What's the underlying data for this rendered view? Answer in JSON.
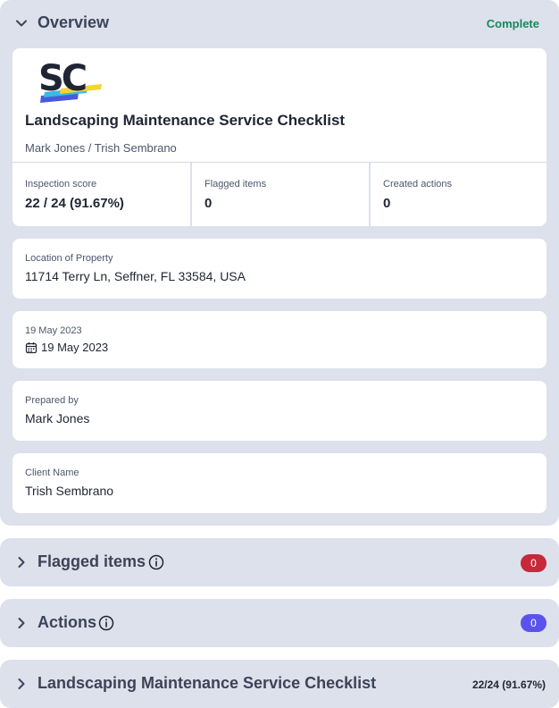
{
  "overview": {
    "title": "Overview",
    "status": "Complete",
    "logo_text": "SC",
    "doc_title": "Landscaping Maintenance Service Checklist",
    "doc_subtitle": "Mark Jones / Trish Sembrano",
    "stats": [
      {
        "label": "Inspection score",
        "value": "22 / 24 (91.67%)"
      },
      {
        "label": "Flagged items",
        "value": "0"
      },
      {
        "label": "Created actions",
        "value": "0"
      }
    ],
    "location": {
      "label": "Location of Property",
      "value": "11714 Terry Ln, Seffner, FL 33584, USA"
    },
    "date": {
      "label": "19 May 2023",
      "value": "19 May 2023",
      "icon": "calendar-icon"
    },
    "prepared_by": {
      "label": "Prepared by",
      "value": "Mark Jones"
    },
    "client": {
      "label": "Client Name",
      "value": "Trish Sembrano"
    }
  },
  "flagged": {
    "title": "Flagged items",
    "count": "0",
    "badge_color": "#c8283a"
  },
  "actions": {
    "title": "Actions",
    "count": "0",
    "badge_color": "#5b52ee"
  },
  "checklist": {
    "title": "Landscaping Maintenance Service Checklist",
    "score": "22/24 (91.67%)"
  },
  "colors": {
    "complete": "#148a5b",
    "section_bg": "#dde1ec",
    "card_bg": "#ffffff"
  }
}
